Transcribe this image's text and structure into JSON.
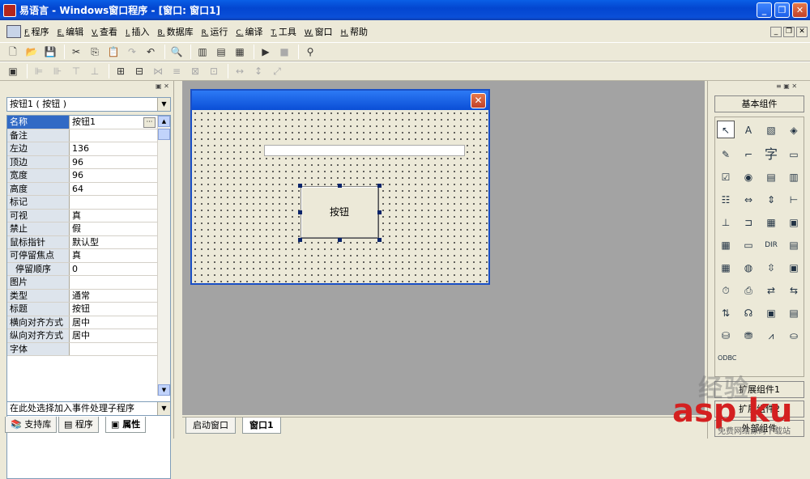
{
  "window": {
    "title": "易语言 - Windows窗口程序 - [窗口: 窗口1]"
  },
  "menu": [
    {
      "key": "F.",
      "label": "程序"
    },
    {
      "key": "E.",
      "label": "编辑"
    },
    {
      "key": "V.",
      "label": "查看"
    },
    {
      "key": "I.",
      "label": "插入"
    },
    {
      "key": "B.",
      "label": "数据库"
    },
    {
      "key": "R.",
      "label": "运行"
    },
    {
      "key": "C.",
      "label": "编译"
    },
    {
      "key": "T.",
      "label": "工具"
    },
    {
      "key": "W.",
      "label": "窗口"
    },
    {
      "key": "H.",
      "label": "帮助"
    }
  ],
  "left": {
    "object_select": "按钮1 ( 按钮 )",
    "properties": [
      {
        "name": "名称",
        "value": "按钮1"
      },
      {
        "name": "备注",
        "value": ""
      },
      {
        "name": "左边",
        "value": "136"
      },
      {
        "name": "顶边",
        "value": "96"
      },
      {
        "name": "宽度",
        "value": "96"
      },
      {
        "name": "高度",
        "value": "64"
      },
      {
        "name": "标记",
        "value": ""
      },
      {
        "name": "可视",
        "value": "真"
      },
      {
        "name": "禁止",
        "value": "假"
      },
      {
        "name": "鼠标指针",
        "value": "默认型"
      },
      {
        "name": "可停留焦点",
        "value": "真"
      },
      {
        "name": "  停留顺序",
        "value": "0"
      },
      {
        "name": "图片",
        "value": ""
      },
      {
        "name": "类型",
        "value": "通常"
      },
      {
        "name": "标题",
        "value": "按钮"
      },
      {
        "name": "横向对齐方式",
        "value": "居中"
      },
      {
        "name": "纵向对齐方式",
        "value": "居中"
      },
      {
        "name": "字体",
        "value": ""
      }
    ],
    "event_select": "在此处选择加入事件处理子程序",
    "tabs": [
      "支持库",
      "程序",
      "属性"
    ]
  },
  "form": {
    "button_caption": "按钮"
  },
  "bottom_tabs": [
    "启动窗口",
    "窗口1"
  ],
  "right": {
    "basic_components": "基本组件",
    "extended_components": "扩展组件1",
    "extended_components2": "扩展组件2",
    "external_components": "外部组件"
  },
  "watermark": {
    "line1": "经验",
    "line2": "asp ku",
    "line3": "免费网络源码下载站"
  }
}
